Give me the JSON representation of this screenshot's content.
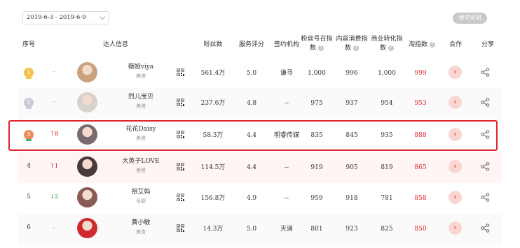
{
  "filter": {
    "date_range": "2019-6-3 - 2019-6-9"
  },
  "header_button": "榜单说明",
  "columns": {
    "rank": "序号",
    "influencer": "达人信息",
    "fans": "粉丝数",
    "service": "服务评分",
    "agency": "签约机构",
    "fan_call": "粉丝号召指数",
    "content": "内容消费指数",
    "commerce": "商业转化指数",
    "taobao": "淘指数",
    "cooperate": "合作",
    "share": "分享"
  },
  "rows": [
    {
      "rank": "1",
      "medal": "gold",
      "change": "-",
      "dir": "same",
      "name": "薇娅viya",
      "category": "美搭",
      "fans": "561.4万",
      "service": "5.0",
      "agency": "谦寻",
      "fan_call": "1,000",
      "content": "996",
      "commerce": "1,000",
      "taobao": "999",
      "avatar_color": "#caa27e"
    },
    {
      "rank": "2",
      "medal": "silver",
      "change": "-",
      "dir": "same",
      "name": "烈儿宝贝",
      "category": "美搭",
      "fans": "237.6万",
      "service": "4.8",
      "agency": "--",
      "fan_call": "975",
      "content": "937",
      "commerce": "954",
      "taobao": "953",
      "avatar_color": "#d7d2cc"
    },
    {
      "rank": "3",
      "medal": "bronze",
      "change": "↑8",
      "dir": "up",
      "name": "花花Daisy",
      "category": "美搭",
      "fans": "58.3万",
      "service": "4.4",
      "agency": "明睿传媒",
      "fan_call": "835",
      "content": "845",
      "commerce": "935",
      "taobao": "888",
      "avatar_color": "#7a6a70"
    },
    {
      "rank": "4",
      "medal": "",
      "change": "↑1",
      "dir": "up",
      "name": "大英子LOVE",
      "category": "美搭",
      "fans": "114.5万",
      "service": "4.4",
      "agency": "--",
      "fan_call": "919",
      "content": "905",
      "commerce": "819",
      "taobao": "865",
      "avatar_color": "#4a3b3a"
    },
    {
      "rank": "5",
      "medal": "",
      "change": "↓2",
      "dir": "down",
      "name": "祖艾妈",
      "category": "母婴",
      "fans": "156.8万",
      "service": "4.9",
      "agency": "--",
      "fan_call": "959",
      "content": "918",
      "commerce": "781",
      "taobao": "858",
      "avatar_color": "#8a5a55"
    },
    {
      "rank": "6",
      "medal": "",
      "change": "-",
      "dir": "same",
      "name": "黄小敏",
      "category": "美食",
      "fans": "14.3万",
      "service": "5.0",
      "agency": "天道",
      "fan_call": "801",
      "content": "923",
      "commerce": "825",
      "taobao": "850",
      "avatar_color": "#d02a2f"
    }
  ],
  "colors": {
    "accent": "#e0242a",
    "up": "#e0242a",
    "down": "#1a9b3a",
    "gold": "#f2c14e",
    "silver": "#c9ccd6",
    "bronze": "#f08a5d"
  }
}
